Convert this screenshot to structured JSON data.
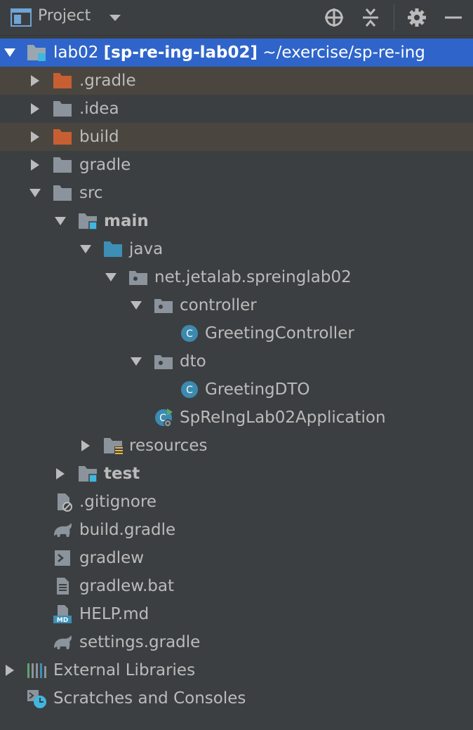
{
  "header": {
    "title": "Project",
    "buttons": [
      "locate-icon",
      "collapse-all-icon",
      "gear-icon",
      "hide-icon"
    ]
  },
  "tree": {
    "root": {
      "name": "lab02",
      "module": "[sp-re-ing-lab02]",
      "path": "~/exercise/sp-re-ing"
    },
    "gradle_dir": ".gradle",
    "idea_dir": ".idea",
    "build_dir": "build",
    "gradle_folder": "gradle",
    "src": "src",
    "main": "main",
    "java": "java",
    "package": "net.jetalab.spreinglab02",
    "controller": "controller",
    "greeting_controller": "GreetingController",
    "dto": "dto",
    "greeting_dto": "GreetingDTO",
    "application": "SpReIngLab02Application",
    "resources": "resources",
    "test": "test",
    "gitignore": ".gitignore",
    "build_gradle": "build.gradle",
    "gradlew": "gradlew",
    "gradlew_bat": "gradlew.bat",
    "help_md": "HELP.md",
    "settings_gradle": "settings.gradle",
    "external_libraries": "External Libraries",
    "scratches": "Scratches and Consoles"
  },
  "colors": {
    "background": "#3c3f41",
    "selection": "#2f65ca",
    "excluded_row": "#4a463f",
    "excluded_folder": "#c75f33",
    "folder": "#8b949c",
    "source_folder": "#3d8fb6",
    "class_icon": "#3c8ab0"
  }
}
